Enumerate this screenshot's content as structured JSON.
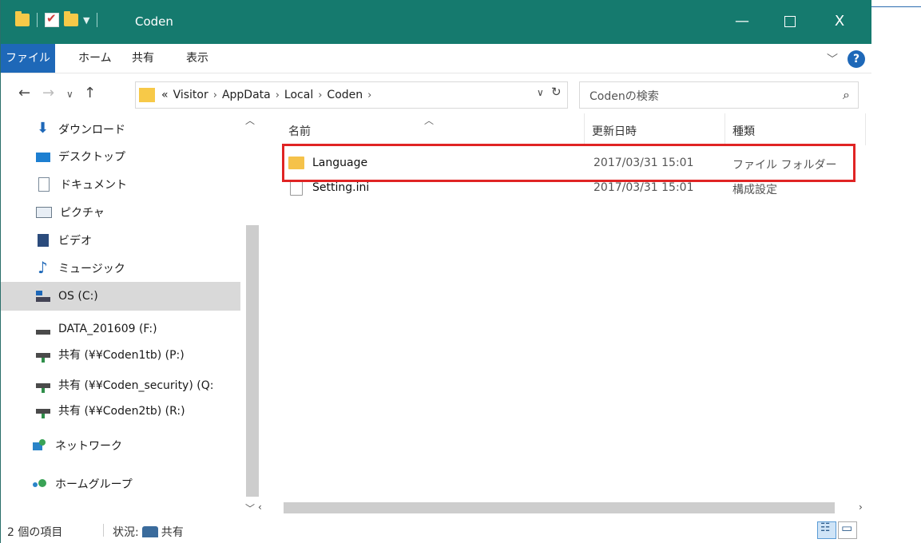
{
  "window": {
    "title": "Coden",
    "controls": {
      "minimize": "—",
      "maximize": "",
      "close": "X"
    }
  },
  "ribbon": {
    "tabs": [
      "ファイル",
      "ホーム",
      "共有",
      "表示"
    ],
    "help": "?"
  },
  "address": {
    "overflow": "«",
    "crumbs": [
      "Visitor",
      "AppData",
      "Local",
      "Coden"
    ],
    "search_placeholder": "Codenの検索"
  },
  "nav_pane": {
    "items": [
      {
        "label": "ダウンロード",
        "icon": "download-icon"
      },
      {
        "label": "デスクトップ",
        "icon": "desktop-icon"
      },
      {
        "label": "ドキュメント",
        "icon": "document-icon"
      },
      {
        "label": "ピクチャ",
        "icon": "picture-icon"
      },
      {
        "label": "ビデオ",
        "icon": "video-icon"
      },
      {
        "label": "ミュージック",
        "icon": "music-icon"
      },
      {
        "label": "OS (C:)",
        "icon": "os-drive-icon",
        "selected": true
      },
      {
        "label": "DATA_201609 (F:)",
        "icon": "drive-icon"
      },
      {
        "label": "共有 (¥¥Coden1tb) (P:)",
        "icon": "network-drive-icon"
      },
      {
        "label": "共有 (¥¥Coden_security) (Q:",
        "icon": "network-drive-icon"
      },
      {
        "label": "共有 (¥¥Coden2tb) (R:)",
        "icon": "network-drive-icon"
      },
      {
        "label": "ネットワーク",
        "icon": "network-icon"
      },
      {
        "label": "ホームグループ",
        "icon": "homegroup-icon"
      }
    ]
  },
  "content": {
    "columns": {
      "name": "名前",
      "date": "更新日時",
      "type": "種類"
    },
    "rows": [
      {
        "name": "Language",
        "date": "2017/03/31 15:01",
        "type": "ファイル フォルダー",
        "icon": "folder-icon"
      },
      {
        "name": "Setting.ini",
        "date": "2017/03/31 15:01",
        "type": "構成設定",
        "icon": "ini-file-icon"
      }
    ],
    "highlight_color": "#e02424"
  },
  "status": {
    "count": "2 個の項目",
    "state": "状況: ",
    "state_value": "共有"
  },
  "colors": {
    "titlebar": "#157a6e",
    "accent": "#1e68b8"
  }
}
